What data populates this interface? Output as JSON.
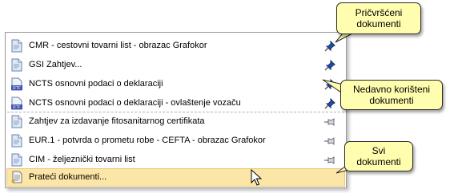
{
  "menu": {
    "items": [
      {
        "label": "CMR - cestovni tovarni list - obrazac Grafokor",
        "icon": "document-icon",
        "pin": "pinned-icon"
      },
      {
        "label": "GSI Zahtjev...",
        "icon": "document-icon",
        "pin": "pinned-icon"
      },
      {
        "label": "NCTS osnovni podaci o deklaraciji",
        "icon": "rtf-document-icon",
        "pin": "pinned-icon"
      },
      {
        "label": "NCTS osnovni podaci o deklaraciji - ovlaštenje vozaču",
        "icon": "rtf-document-icon",
        "pin": "pinned-icon"
      },
      {
        "label": "Zahtjev za izdavanje fitosanitarnog certifikata",
        "icon": "document-icon",
        "pin": "unpinned-icon"
      },
      {
        "label": "EUR.1 - potvrda o prometu robe - CEFTA - obrazac Grafokor",
        "icon": "document-icon",
        "pin": "unpinned-icon"
      },
      {
        "label": "CIM - željeznički tovarni list",
        "icon": "document-icon",
        "pin": "unpinned-icon"
      }
    ],
    "all_documents": {
      "label": "Prateći dokumenti...",
      "icon": "document-list-icon"
    }
  },
  "callouts": {
    "pinned": {
      "line1": "Pričvršćeni",
      "line2": "dokumenti"
    },
    "recent": {
      "line1": "Nedavno korišteni",
      "line2": "dokumenti"
    },
    "all": {
      "line1": "Svi",
      "line2": "dokumenti"
    }
  },
  "colors": {
    "callout_fill": "#fffdae",
    "hover_fill": "#fbe6a8",
    "pin_blue": "#1f4fa8"
  }
}
